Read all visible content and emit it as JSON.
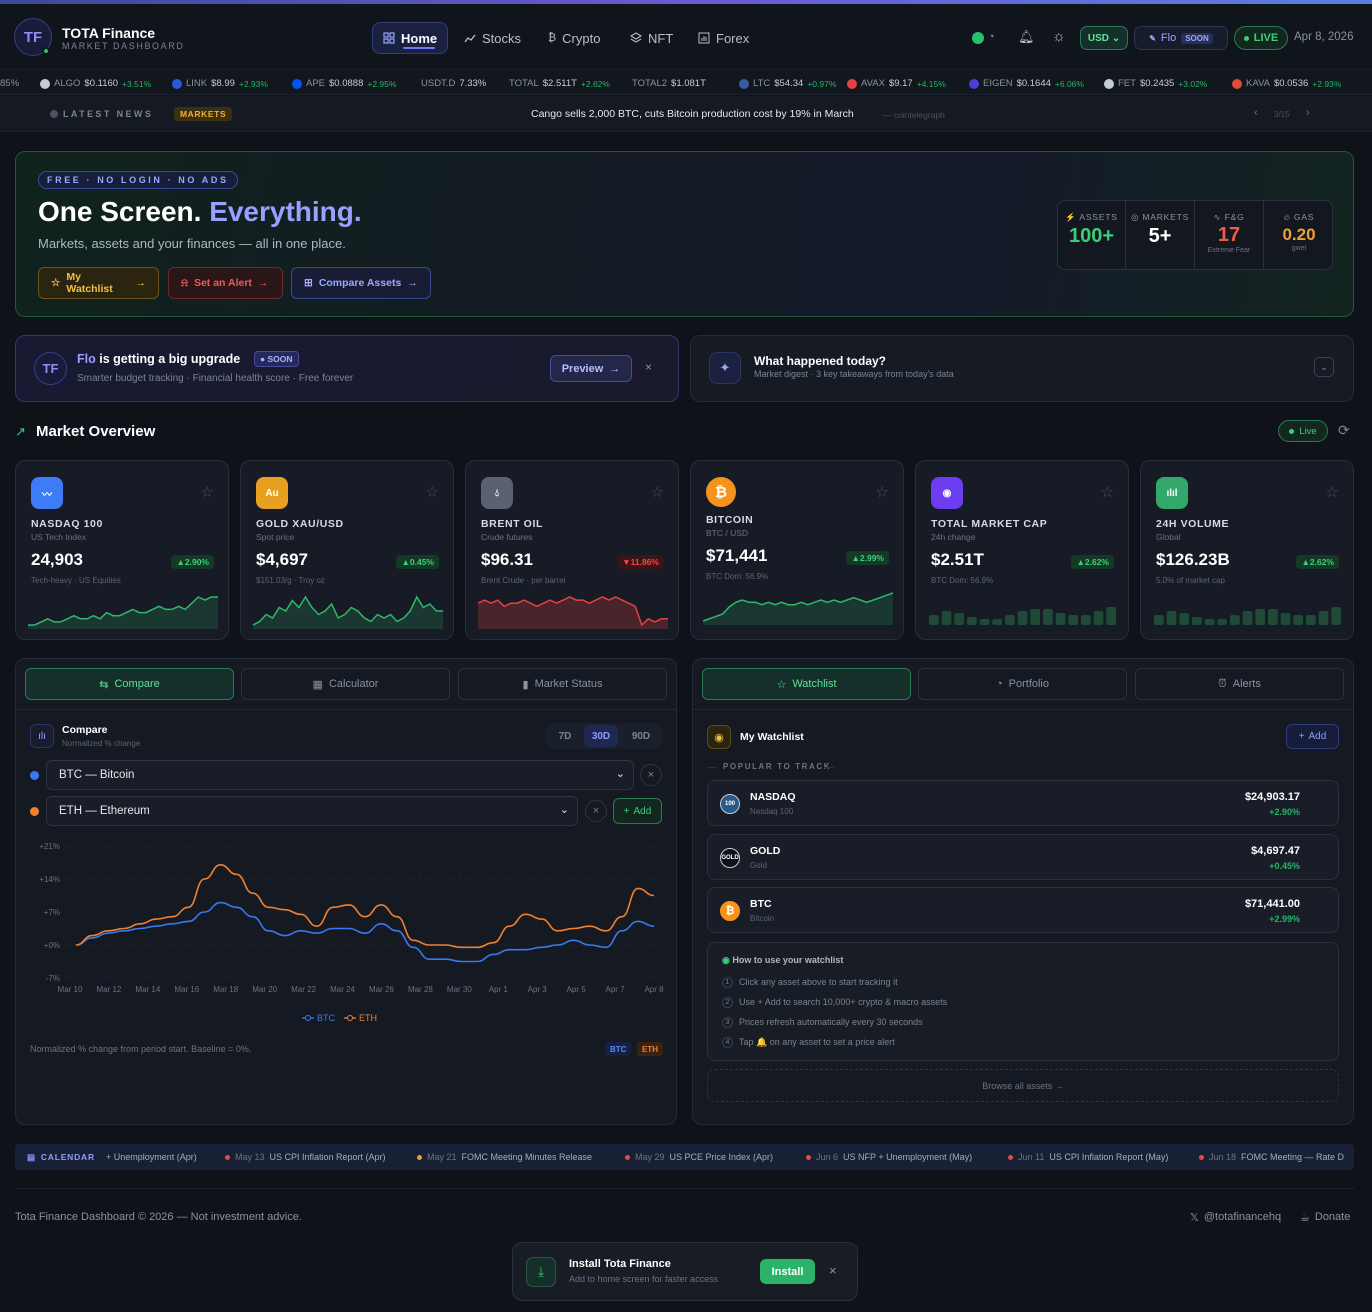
{
  "header": {
    "logo_text": "TF",
    "brand": "TOTA Finance",
    "subtitle": "MARKET DASHBOARD",
    "nav": [
      {
        "label": "Home",
        "icon": "grid-icon"
      },
      {
        "label": "Stocks",
        "icon": "trend-icon"
      },
      {
        "label": "Crypto",
        "icon": "bitcoin-icon"
      },
      {
        "label": "NFT",
        "icon": "layers-icon"
      },
      {
        "label": "Forex",
        "icon": "bars-icon"
      }
    ],
    "currency": "USD",
    "flo_label": "Flo",
    "flo_badge": "SOON",
    "live_label": "LIVE",
    "date": "Apr 8, 2026"
  },
  "ticker": [
    {
      "sym": "85%",
      "price": "",
      "chg": "",
      "color": ""
    },
    {
      "sym": "ALGO",
      "price": "$0.1160",
      "chg": "+3.51%",
      "color": "#c7cdd8"
    },
    {
      "sym": "LINK",
      "price": "$8.99",
      "chg": "+2.93%",
      "color": "#2a5ada"
    },
    {
      "sym": "APE",
      "price": "$0.0888",
      "chg": "+2.95%",
      "color": "#0054f9"
    },
    {
      "sym": "USDT.D",
      "price": "7.33%",
      "chg": "",
      "color": ""
    },
    {
      "sym": "TOTAL",
      "price": "$2.511T",
      "chg": "+2.62%",
      "color": ""
    },
    {
      "sym": "TOTAL2",
      "price": "$1.081T",
      "chg": "",
      "color": ""
    },
    {
      "sym": "LTC",
      "price": "$54.34",
      "chg": "+0.97%",
      "color": "#345d9d"
    },
    {
      "sym": "AVAX",
      "price": "$9.17",
      "chg": "+4.15%",
      "color": "#e84142"
    },
    {
      "sym": "EIGEN",
      "price": "$0.1644",
      "chg": "+6.06%",
      "color": "#4a3fd6"
    },
    {
      "sym": "FET",
      "price": "$0.2435",
      "chg": "+3.02%",
      "color": "#c7cdd8"
    },
    {
      "sym": "KAVA",
      "price": "$0.0536",
      "chg": "+2.93%",
      "color": "#e4483e"
    }
  ],
  "news": {
    "label": "LATEST NEWS",
    "badge": "MARKETS",
    "headline": "Cango sells 2,000 BTC, cuts Bitcoin production cost by 19% in March",
    "source": "— cointelegraph",
    "pager": "3/15"
  },
  "hero": {
    "tag": "FREE · NO LOGIN · NO ADS",
    "title_a": "One Screen.",
    "title_b": "Everything.",
    "subtitle": "Markets, assets and your finances — all in one place.",
    "btn_watchlist": "My Watchlist",
    "btn_alert": "Set an Alert",
    "btn_compare": "Compare Assets",
    "stats": [
      {
        "label": "ASSETS",
        "value": "100+",
        "sub": "",
        "color": "#3ad07a"
      },
      {
        "label": "MARKETS",
        "value": "5+",
        "sub": "",
        "color": "#ffffff"
      },
      {
        "label": "F&G",
        "value": "17",
        "sub": "Extreme Fear",
        "color": "#f05a4a"
      },
      {
        "label": "GAS",
        "value": "0.20",
        "sub": "gwei",
        "color": "#f0a030"
      }
    ]
  },
  "flo": {
    "name": "Flo",
    "title_rest": "is getting a big upgrade",
    "badge": "SOON",
    "desc": "Smarter budget tracking · Financial health score · Free forever",
    "preview": "Preview"
  },
  "digest": {
    "title": "What happened today?",
    "desc": "Market digest · 3 key takeaways from today's data"
  },
  "overview": {
    "title": "Market Overview",
    "live": "Live"
  },
  "markets": [
    {
      "name": "NASDAQ 100",
      "desc": "US Tech Index",
      "price": "24,903",
      "chg": "2.90%",
      "up": true,
      "note": "Tech-heavy · US Equities",
      "icon": "chart-icon",
      "icon_text": "",
      "color": "#3d7bf7",
      "spark": [
        3,
        3,
        4,
        5,
        4,
        4,
        5,
        6,
        5,
        5,
        6,
        5,
        7,
        6,
        6,
        7,
        8,
        7,
        7,
        8,
        9,
        8,
        8,
        9,
        8,
        10,
        12,
        11,
        12,
        12
      ]
    },
    {
      "name": "GOLD XAU/USD",
      "desc": "Spot price",
      "price": "$4,697",
      "chg": "0.45%",
      "up": true,
      "note": "$151.03/g · Troy oz",
      "icon": "gold-icon",
      "icon_text": "Au",
      "color": "#e8a020",
      "spark": [
        4,
        5,
        7,
        6,
        9,
        8,
        11,
        9,
        12,
        9,
        7,
        8,
        10,
        6,
        7,
        9,
        8,
        6,
        5,
        7,
        6,
        7,
        5,
        6,
        8,
        12,
        9,
        10,
        8,
        8
      ]
    },
    {
      "name": "BRENT OIL",
      "desc": "Crude futures",
      "price": "$96.31",
      "chg": "11.86%",
      "up": false,
      "note": "Brent Crude · per barrel",
      "icon": "drop-icon",
      "icon_text": "",
      "color": "#5a6172",
      "spark": [
        10,
        11,
        10,
        11,
        9,
        10,
        10,
        11,
        10,
        9,
        10,
        11,
        10,
        11,
        12,
        11,
        11,
        10,
        11,
        12,
        11,
        12,
        11,
        10,
        9,
        3,
        5,
        4,
        5,
        5
      ]
    },
    {
      "name": "BITCOIN",
      "desc": "BTC / USD",
      "price": "$71,441",
      "chg": "2.99%",
      "up": true,
      "note": "BTC Dom: 56.9%",
      "icon": "bitcoin-icon",
      "icon_text": "₿",
      "color": "#f7931a",
      "spark": [
        2,
        3,
        4,
        5,
        8,
        10,
        11,
        10,
        10,
        9,
        10,
        9,
        10,
        9,
        9,
        10,
        9,
        10,
        11,
        10,
        11,
        10,
        11,
        12,
        11,
        10,
        11,
        12,
        13,
        14
      ]
    },
    {
      "name": "TOTAL MARKET CAP",
      "desc": "24h change",
      "price": "$2.51T",
      "chg": "2.62%",
      "up": true,
      "note": "BTC Dom: 56.9%",
      "icon": "target-icon",
      "icon_text": "",
      "color": "#6d3df2",
      "bars": [
        3,
        5,
        4,
        2,
        1,
        1,
        3,
        5,
        6,
        6,
        4,
        3,
        3,
        5,
        7
      ]
    },
    {
      "name": "24H VOLUME",
      "desc": "Global",
      "price": "$126.23B",
      "chg": "2.62%",
      "up": true,
      "note": "5.0% of market cap",
      "icon": "volume-icon",
      "icon_text": "",
      "color": "#34a86a",
      "bars": [
        3,
        5,
        4,
        2,
        1,
        1,
        3,
        5,
        6,
        6,
        4,
        3,
        3,
        5,
        7
      ]
    }
  ],
  "left_tabs": [
    "Compare",
    "Calculator",
    "Market Status"
  ],
  "compare": {
    "title": "Compare",
    "subtitle": "Normalized % change",
    "ranges": [
      "7D",
      "30D",
      "90D"
    ],
    "asset1": "BTC — Bitcoin",
    "asset2": "ETH — Ethereum",
    "add": "Add",
    "footnote": "Normalized % change from period start. Baseline = 0%.",
    "tag_btc": "BTC",
    "tag_eth": "ETH"
  },
  "chart_data": {
    "type": "line",
    "ylim": [
      -7,
      21
    ],
    "yticks": [
      "+21%",
      "+14%",
      "+7%",
      "+0%",
      "-7%"
    ],
    "ytick_values": [
      21,
      14,
      7,
      0,
      -7
    ],
    "xticks": [
      "Mar 10",
      "Mar 12",
      "Mar 14",
      "Mar 16",
      "Mar 18",
      "Mar 20",
      "Mar 22",
      "Mar 24",
      "Mar 26",
      "Mar 28",
      "Mar 30",
      "Apr 1",
      "Apr 3",
      "Apr 5",
      "Apr 7",
      "Apr 8"
    ],
    "series": [
      {
        "name": "BTC",
        "color": "#3a78f0",
        "values": [
          0,
          1.5,
          2.5,
          3,
          3.5,
          4,
          4.5,
          5,
          7,
          9,
          8,
          6,
          3,
          2,
          3,
          2.5,
          3.5,
          3.5,
          2.5,
          4.5,
          3,
          -0.5,
          -3,
          -3,
          -3.5,
          -3.5,
          -2,
          -1,
          -1,
          -0.5,
          0,
          1,
          0,
          -0.5,
          3,
          5,
          4
        ]
      },
      {
        "name": "ETH",
        "color": "#f08030",
        "values": [
          0,
          2,
          3,
          3.5,
          4.5,
          5.5,
          6,
          8,
          14,
          17,
          15,
          11,
          8,
          7.5,
          6.5,
          4,
          8,
          8.5,
          6,
          8.5,
          6,
          1,
          0,
          0,
          -0.5,
          -0.5,
          0.5,
          4,
          6.5,
          5.5,
          3,
          3.5,
          4,
          3,
          6,
          12,
          10.5
        ]
      }
    ]
  },
  "right_tabs": [
    "Watchlist",
    "Portfolio",
    "Alerts"
  ],
  "watchlist": {
    "title": "My Watchlist",
    "add": "Add",
    "section": "POPULAR TO TRACK",
    "items": [
      {
        "name": "NASDAQ",
        "desc": "Nasdaq 100",
        "price": "$24,903.17",
        "chg": "+2.90%",
        "icon_text": "100",
        "color": "#2a5a8a"
      },
      {
        "name": "GOLD",
        "desc": "Gold",
        "price": "$4,697.47",
        "chg": "+0.45%",
        "icon_text": "GOLD",
        "color": "#0e1116"
      },
      {
        "name": "BTC",
        "desc": "Bitcoin",
        "price": "$71,441.00",
        "chg": "+2.99%",
        "icon_text": "₿",
        "color": "#f7931a"
      }
    ],
    "howto_title": "How to use your watchlist",
    "howto": [
      "Click any asset above to start tracking it",
      "Use + Add to search 10,000+ crypto & macro assets",
      "Prices refresh automatically every 30 seconds",
      "Tap 🔔 on any asset to set a price alert"
    ],
    "browse": "Browse all assets →"
  },
  "calendar": {
    "label": "CALENDAR",
    "events": [
      {
        "date": "",
        "text": "+ Unemployment (Apr)",
        "color": ""
      },
      {
        "date": "May 13",
        "text": "US CPI Inflation Report (Apr)",
        "color": "#e8484a"
      },
      {
        "date": "May 21",
        "text": "FOMC Meeting Minutes Release",
        "color": "#f0a020"
      },
      {
        "date": "May 29",
        "text": "US PCE Price Index (Apr)",
        "color": "#e8484a"
      },
      {
        "date": "Jun 6",
        "text": "US NFP + Unemployment (May)",
        "color": "#e8484a"
      },
      {
        "date": "Jun 11",
        "text": "US CPI Inflation Report (May)",
        "color": "#e8484a"
      },
      {
        "date": "Jun 18",
        "text": "FOMC Meeting — Rate D",
        "color": "#e8484a"
      }
    ]
  },
  "footer": {
    "copyright": "Tota Finance Dashboard © 2026 — Not investment advice.",
    "twitter": "@totafinancehq",
    "donate": "Donate"
  },
  "install": {
    "title": "Install Tota Finance",
    "desc": "Add to home screen for faster access",
    "button": "Install"
  }
}
